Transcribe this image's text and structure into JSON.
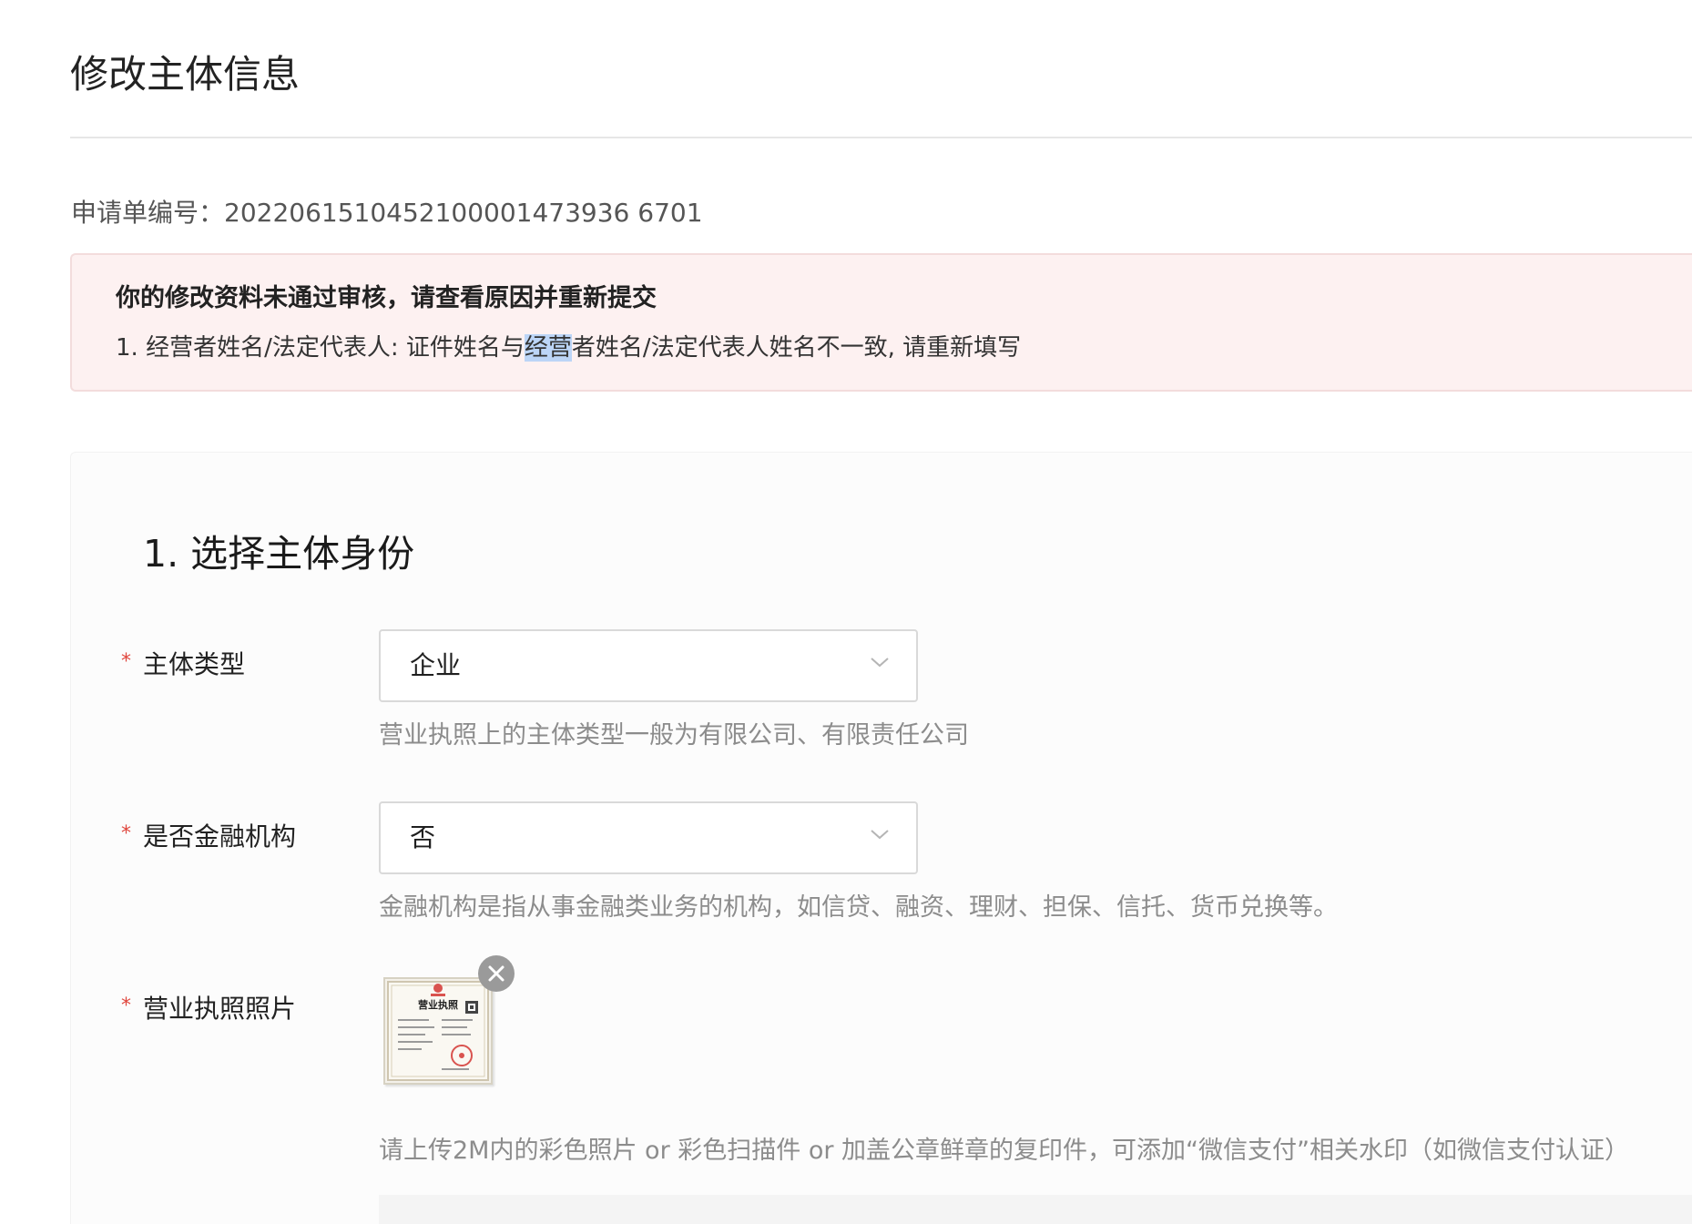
{
  "page": {
    "title": "修改主体信息"
  },
  "application": {
    "number_text": "申请单编号：2022061510452100001473936 6701"
  },
  "alert": {
    "title": "你的修改资料未通过审核，请查看原因并重新提交",
    "reason_prefix": "1. 经营者姓名/法定代表人: 证件姓名与",
    "reason_highlight": "经营",
    "reason_suffix": "者姓名/法定代表人姓名不一致, 请重新填写"
  },
  "section": {
    "title": "1. 选择主体身份"
  },
  "fields": {
    "subject_type": {
      "required_mark": "*",
      "label": "主体类型",
      "value": "企业",
      "hint": "营业执照上的主体类型一般为有限公司、有限责任公司"
    },
    "financial_institution": {
      "required_mark": "*",
      "label": "是否金融机构",
      "value": "否",
      "hint": "金融机构是指从事金融类业务的机构，如信贷、融资、理财、担保、信托、货币兑换等。"
    },
    "business_license": {
      "required_mark": "*",
      "label": "营业执照照片",
      "image_title": "营业执照",
      "hint": "请上传2M内的彩色照片 or 彩色扫描件 or 加盖公章鲜章的复印件，可添加“微信支付”相关水印（如微信支付认证）"
    }
  },
  "icons": {
    "select_arrow": "chevron-down-icon",
    "remove": "close-icon"
  },
  "colors": {
    "required": "#e0463d",
    "alert_bg": "#fdf1f1",
    "alert_border": "#f3dcdc",
    "hint": "#8c8c8c",
    "highlight": "#bcd5f7"
  }
}
